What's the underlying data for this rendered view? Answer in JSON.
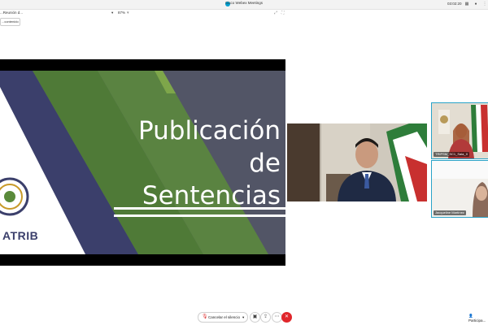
{
  "window": {
    "title": "Cisco Webex Meetings",
    "clock": "03:02:20"
  },
  "info_bar": {
    "meeting_name": "...Reunión d...",
    "zoom_level": "87%",
    "sharing_chip": "...contenido"
  },
  "slide": {
    "title_line1": "Publicación de",
    "title_line2": "Sentencias",
    "logo_text": "ATRIB"
  },
  "videos": {
    "thumb1_name": "TRIPSM_SC1_Sala_II",
    "thumb2_name": "Jacqueline Martínez"
  },
  "controls": {
    "mute_label": "Cancelar el silencio",
    "participants_label": "Participa..."
  },
  "colors": {
    "slide_navy": "#3b3f6b",
    "slide_green": "#5a8a3a",
    "slide_lime": "#7ea64a",
    "end_call": "#e0262b",
    "webex_blue": "#00a0d1"
  }
}
